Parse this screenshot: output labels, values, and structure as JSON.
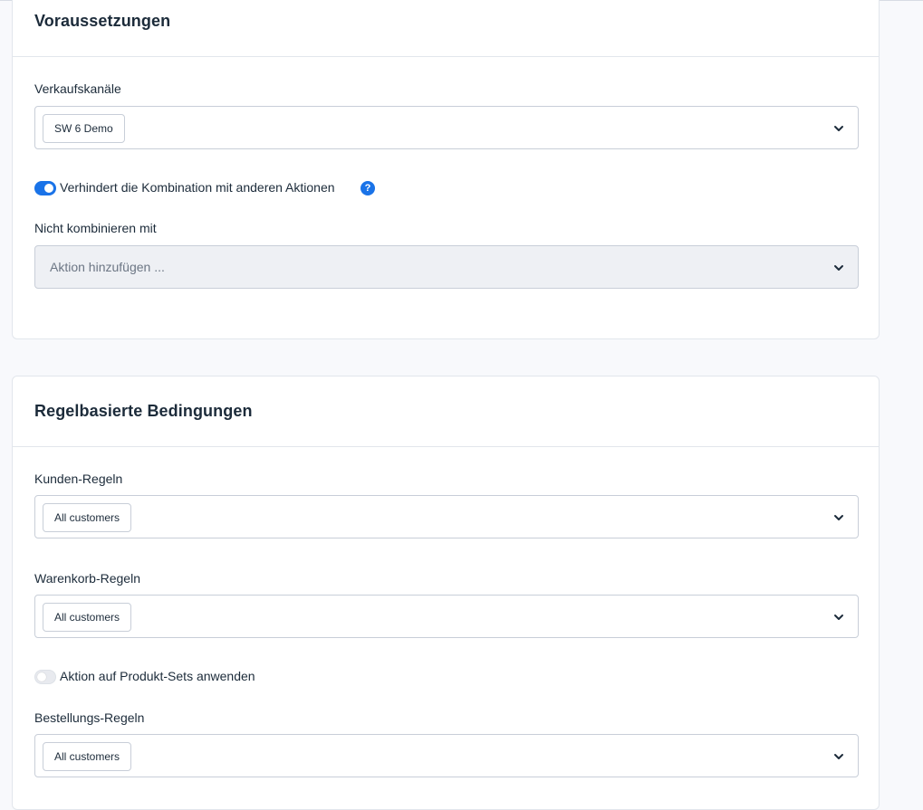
{
  "sections": {
    "requirements": {
      "title": "Voraussetzungen",
      "sales_channels": {
        "label": "Verkaufskanäle",
        "selected": [
          "SW 6 Demo"
        ]
      },
      "prevent_combination": {
        "label": "Verhindert die Kombination mit anderen Aktionen",
        "enabled": true,
        "help_icon": "question-mark"
      },
      "exclusions": {
        "label": "Nicht kombinieren mit",
        "placeholder": "Aktion hinzufügen ..."
      }
    },
    "rule_conditions": {
      "title": "Regelbasierte Bedingungen",
      "customer_rules": {
        "label": "Kunden-Regeln",
        "selected": [
          "All customers"
        ]
      },
      "cart_rules": {
        "label": "Warenkorb-Regeln",
        "selected": [
          "All customers"
        ]
      },
      "apply_to_sets": {
        "label": "Aktion auf Produkt-Sets anwenden",
        "enabled": false
      },
      "order_rules": {
        "label": "Bestellungs-Regeln",
        "selected": [
          "All customers"
        ]
      }
    }
  },
  "colors": {
    "accent": "#1a73e8",
    "border": "#c8ced8",
    "text": "#1c2b3a",
    "page_background": "#f8f9fc"
  }
}
